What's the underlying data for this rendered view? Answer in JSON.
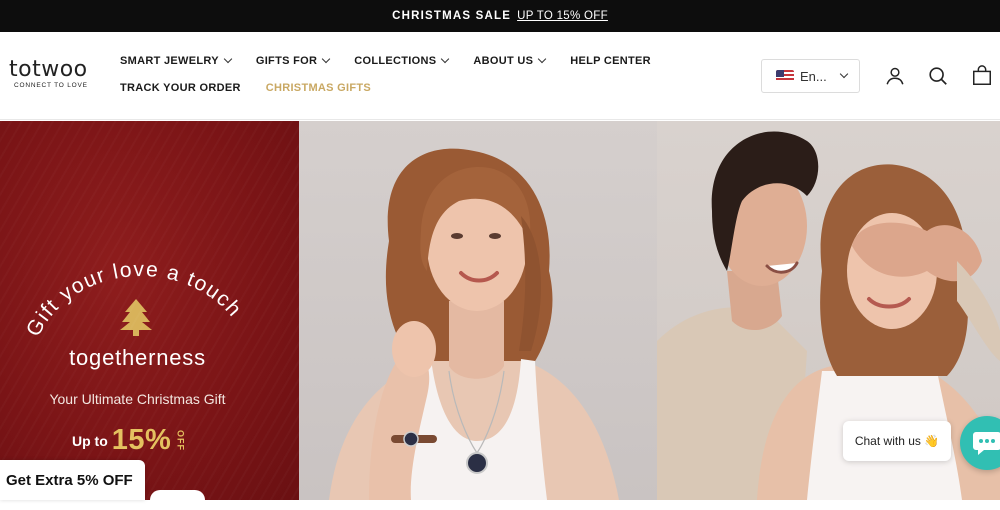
{
  "announcement": {
    "label": "CHRISTMAS SALE",
    "link": "UP TO 15% OFF"
  },
  "brand": {
    "name": "totwoo",
    "tagline": "CONNECT TO LOVE"
  },
  "nav": {
    "row1": [
      {
        "label": "SMART JEWELRY",
        "dropdown": true
      },
      {
        "label": "GIFTS FOR",
        "dropdown": true
      },
      {
        "label": "COLLECTIONS",
        "dropdown": true
      },
      {
        "label": "ABOUT US",
        "dropdown": true
      },
      {
        "label": "HELP CENTER",
        "dropdown": false
      }
    ],
    "row2": [
      {
        "label": "TRACK YOUR ORDER"
      },
      {
        "label": "CHRISTMAS GIFTS",
        "color": "#c9a863"
      }
    ]
  },
  "language": {
    "label": "En...",
    "flag": "us-flag-icon"
  },
  "header_icons": [
    "account-icon",
    "search-icon",
    "cart-icon"
  ],
  "hero": {
    "arc_text": "Gift your love a touch of",
    "headline": "togetherness",
    "subtitle": "Your Ultimate Christmas Gift",
    "offer_prefix": "Up to",
    "offer_value": "15%",
    "offer_suffix": "OFF",
    "panel_color": "#7a1416",
    "accent_color": "#e4c15f"
  },
  "promo_tab": "Get Extra 5% OFF",
  "chat": {
    "bubble": "Chat with us 👋",
    "button_color": "#31bfb3"
  }
}
